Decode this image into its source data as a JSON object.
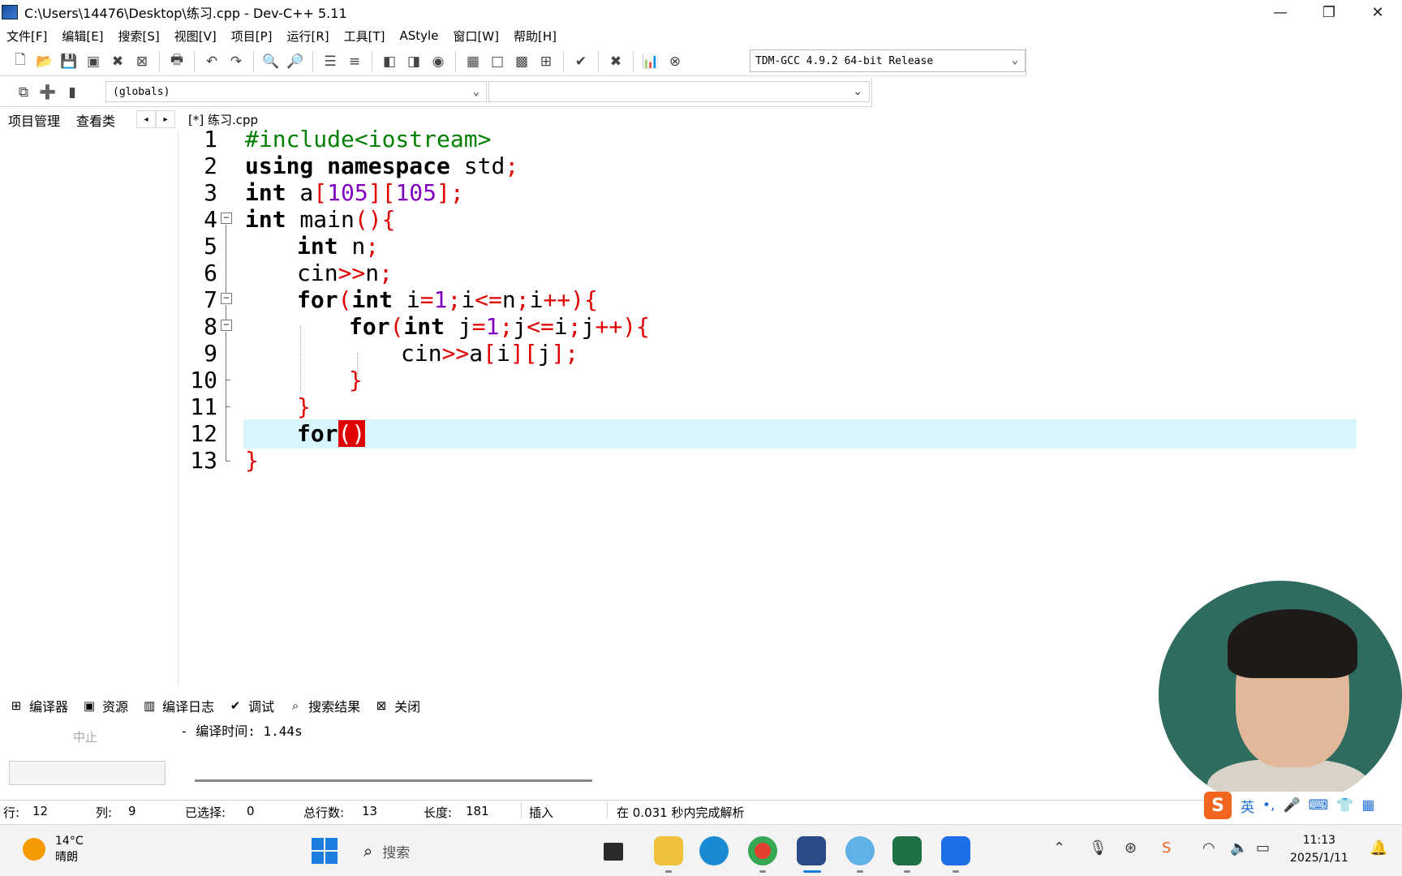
{
  "window": {
    "title": "C:\\Users\\14476\\Desktop\\练习.cpp - Dev-C++ 5.11",
    "minimize": "—",
    "maximize": "❐",
    "close": "✕"
  },
  "menu": [
    "文件[F]",
    "编辑[E]",
    "搜索[S]",
    "视图[V]",
    "项目[P]",
    "运行[R]",
    "工具[T]",
    "AStyle",
    "窗口[W]",
    "帮助[H]"
  ],
  "toolbar": {
    "compiler": "TDM-GCC 4.9.2 64-bit Release",
    "globals": "(globals)"
  },
  "left_tabs": [
    "项目管理",
    "查看类"
  ],
  "editor_tab": "[*] 练习.cpp",
  "code_lines": [
    {
      "num": "1"
    },
    {
      "num": "2"
    },
    {
      "num": "3"
    },
    {
      "num": "4"
    },
    {
      "num": "5"
    },
    {
      "num": "6"
    },
    {
      "num": "7"
    },
    {
      "num": "8"
    },
    {
      "num": "9"
    },
    {
      "num": "10"
    },
    {
      "num": "11"
    },
    {
      "num": "12"
    },
    {
      "num": "13"
    }
  ],
  "code": {
    "l1": "#include<iostream>",
    "l2_kw": "using namespace",
    "l2_rest": " std",
    "l2_sym": ";",
    "l3_kw": "int",
    "l3_a": " a",
    "l3_b1": "[",
    "l3_n1": "105",
    "l3_b2": "][",
    "l3_n2": "105",
    "l3_b3": "];",
    "l4_kw": "int",
    "l4_rest": " main",
    "l4_sym": "(){",
    "l5_kw": "int",
    "l5_rest": " n",
    "l5_sym": ";",
    "l6_rest": "cin",
    "l6_sym1": ">>",
    "l6_n": "n",
    "l6_sym2": ";",
    "l7_kw": "for",
    "l7_p1": "(",
    "l7_kw2": "int",
    "l7_i": " i",
    "l7_eq": "=",
    "l7_one": "1",
    "l7_s1": ";",
    "l7_i2": "i",
    "l7_le": "<=",
    "l7_n": "n",
    "l7_s2": ";",
    "l7_i3": "i",
    "l7_inc": "++){",
    "l8_kw": "for",
    "l8_p1": "(",
    "l8_kw2": "int",
    "l8_j": " j",
    "l8_eq": "=",
    "l8_one": "1",
    "l8_s1": ";",
    "l8_j2": "j",
    "l8_le": "<=",
    "l8_i": "i",
    "l8_s2": ";",
    "l8_j3": "j",
    "l8_inc": "++){",
    "l9_cin": "cin",
    "l9_op": ">>",
    "l9_a": "a",
    "l9_b1": "[",
    "l9_i": "i",
    "l9_b2": "][",
    "l9_j": "j",
    "l9_b3": "];",
    "l10": "}",
    "l11": "}",
    "l12_kw": "for",
    "l12_brk": "()",
    "l13": "}"
  },
  "bottom_tabs": [
    {
      "label": "编译器",
      "icon": "compiler-icon"
    },
    {
      "label": "资源",
      "icon": "resources-icon"
    },
    {
      "label": "编译日志",
      "icon": "compile-log-icon"
    },
    {
      "label": "调试",
      "icon": "debug-icon"
    },
    {
      "label": "搜索结果",
      "icon": "search-results-icon"
    },
    {
      "label": "关闭",
      "icon": "close-panel-icon"
    }
  ],
  "abort_label": "中止",
  "log": "- 编译时间: 1.44s",
  "status": {
    "row_label": "行:",
    "row": "12",
    "col_label": "列:",
    "col": "9",
    "sel_label": "已选择:",
    "sel": "0",
    "total_label": "总行数:",
    "total": "13",
    "len_label": "长度:",
    "len": "181",
    "mode": "插入",
    "parse": "在 0.031 秒内完成解析"
  },
  "ime": {
    "lang": "英"
  },
  "taskbar": {
    "temp": "14°C",
    "weather": "晴朗",
    "search_placeholder": "搜索",
    "time": "11:13",
    "date": "2025/1/11"
  }
}
